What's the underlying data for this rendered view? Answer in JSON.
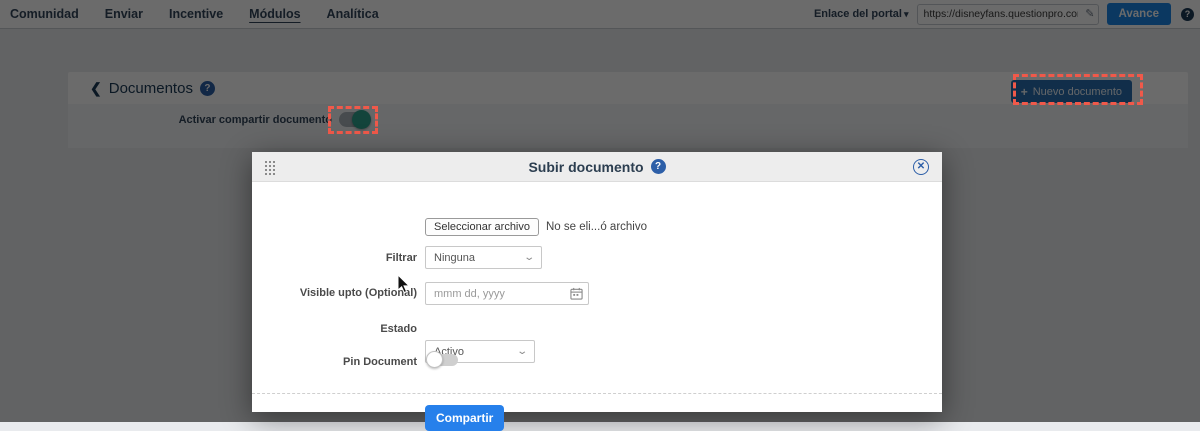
{
  "topnav": {
    "items": [
      {
        "label": "Comunidad"
      },
      {
        "label": "Enviar"
      },
      {
        "label": "Incentive"
      },
      {
        "label": "Módulos",
        "active": true
      },
      {
        "label": "Analítica"
      }
    ],
    "portal_link_label": "Enlace del portal",
    "portal_url": "https://disneyfans.questionpro.com",
    "advance_button_label": "Avance",
    "help_badge": "?"
  },
  "documents_panel": {
    "title": "Documentos",
    "help_badge": "?",
    "new_document_button_label": "Nuevo documento",
    "plus_icon": "+",
    "share_toggle_label": "Activar compartir documento",
    "share_toggle_state": "on"
  },
  "modal": {
    "title": "Subir documento",
    "help_badge": "?",
    "close_icon": "✕",
    "file_button_label": "Seleccionar archivo",
    "file_status_text": "No se eli...ó archivo",
    "filter_label": "Filtrar",
    "filter_value": "Ninguna",
    "visible_upto_label": "Visible upto (Optional)",
    "visible_upto_placeholder": "mmm dd, yyyy",
    "estado_label": "Estado",
    "estado_value": "Activo",
    "pin_label": "Pin Document",
    "pin_toggle_state": "off",
    "submit_button_label": "Compartir"
  },
  "colors": {
    "accent_blue": "#1b87e6",
    "submit_blue": "#2680eb",
    "navy_text": "#1b3a57",
    "annotation_red": "#f0594a",
    "toggle_on_teal": "#2fa28e",
    "overlay": "rgba(0,0,0,0.58)"
  }
}
